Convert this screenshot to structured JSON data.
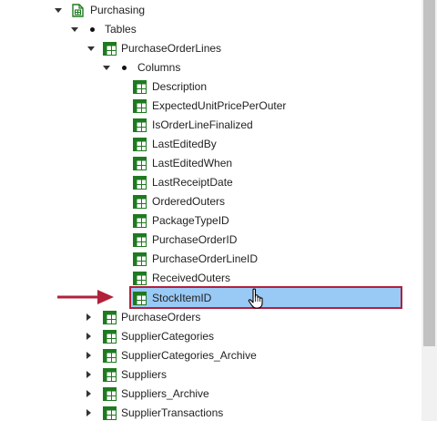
{
  "tree": {
    "schema": {
      "label": "Purchasing",
      "icon": "schema-document-icon"
    },
    "tables_folder": {
      "label": "Tables"
    },
    "table_expanded": {
      "label": "PurchaseOrderLines",
      "icon": "table-icon"
    },
    "columns_folder": {
      "label": "Columns"
    },
    "columns": [
      {
        "label": "Description"
      },
      {
        "label": "ExpectedUnitPricePerOuter"
      },
      {
        "label": "IsOrderLineFinalized"
      },
      {
        "label": "LastEditedBy"
      },
      {
        "label": "LastEditedWhen"
      },
      {
        "label": "LastReceiptDate"
      },
      {
        "label": "OrderedOuters"
      },
      {
        "label": "PackageTypeID"
      },
      {
        "label": "PurchaseOrderID"
      },
      {
        "label": "PurchaseOrderLineID"
      },
      {
        "label": "ReceivedOuters"
      },
      {
        "label": "StockItemID",
        "selected": true
      }
    ],
    "tables": [
      {
        "label": "PurchaseOrders"
      },
      {
        "label": "SupplierCategories"
      },
      {
        "label": "SupplierCategories_Archive"
      },
      {
        "label": "Suppliers"
      },
      {
        "label": "Suppliers_Archive"
      },
      {
        "label": "SupplierTransactions"
      }
    ]
  },
  "colors": {
    "selection_fill": "#99c9f5",
    "selection_border": "#b0213b",
    "annotation_arrow": "#b0213b",
    "icon_green": "#1e7a1e"
  }
}
